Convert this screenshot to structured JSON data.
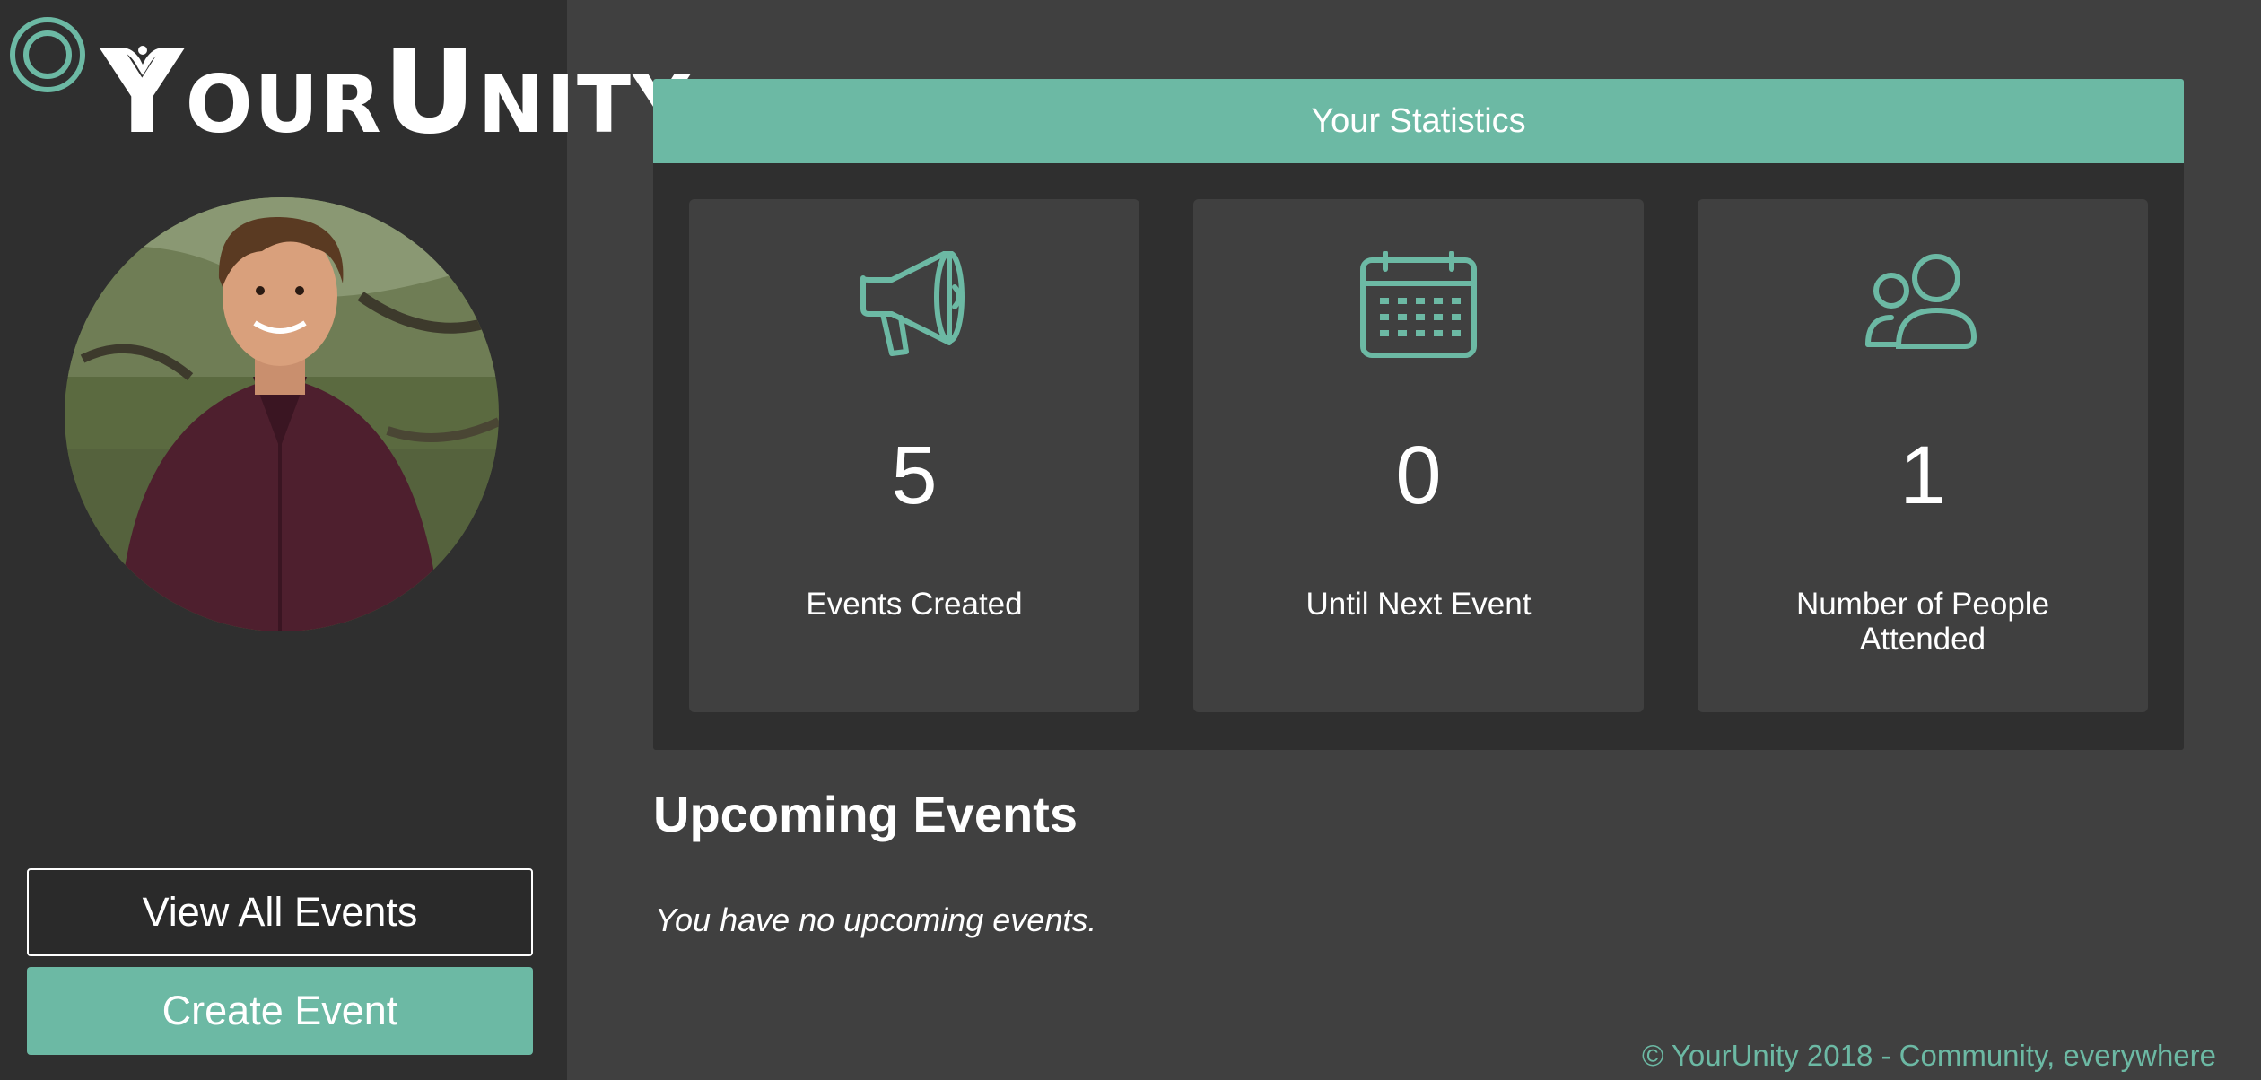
{
  "brand": {
    "logo_text_prefix": "Y",
    "logo_text_mid": "OUR",
    "logo_text_u": "U",
    "logo_text_suffix": "NITY",
    "accent_color": "#6cb9a4"
  },
  "sidebar": {
    "view_all_label": "View All Events",
    "create_label": "Create Event"
  },
  "stats": {
    "header": "Your Statistics",
    "cards": [
      {
        "icon": "megaphone-icon",
        "value": "5",
        "label": "Events Created"
      },
      {
        "icon": "calendar-icon",
        "value": "0",
        "label": "Until Next Event"
      },
      {
        "icon": "people-icon",
        "value": "1",
        "label": "Number of People Attended"
      }
    ]
  },
  "upcoming": {
    "title": "Upcoming Events",
    "empty_message": "You have no upcoming events."
  },
  "footer": {
    "text": "© YourUnity 2018 - Community, everywhere"
  }
}
